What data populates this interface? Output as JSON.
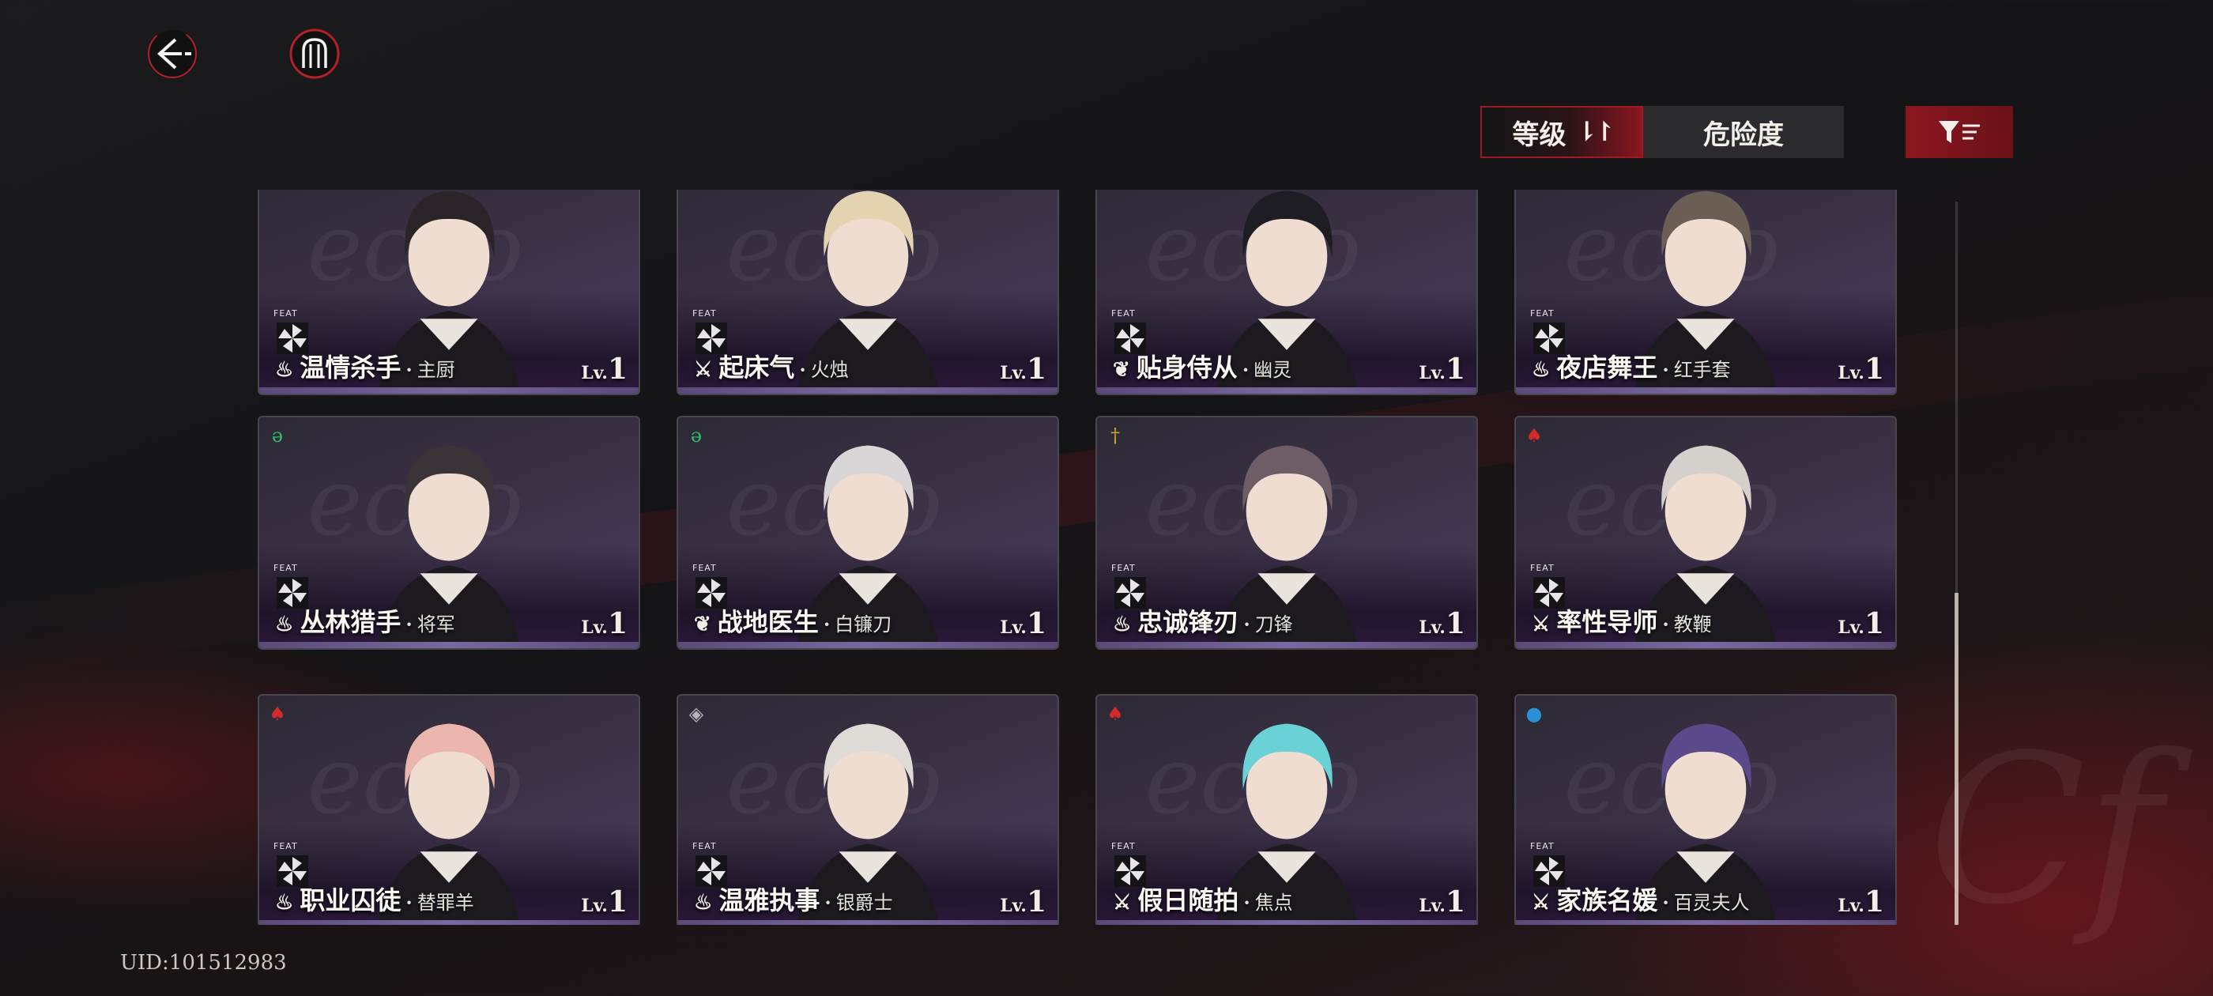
{
  "uid": "UID:101512983",
  "sort": {
    "level_label": "等级",
    "danger_label": "危险度"
  },
  "icons": {
    "back": "back-arrow-icon",
    "menu": "menu-emblem-icon",
    "filter": "filter-icon",
    "sort": "sort-arrows-icon"
  },
  "colors": {
    "accent_red": "#a01a24",
    "card_purple": "#4b3d5e",
    "green_tag": "#2fbf6a",
    "red_tag": "#d32a2a",
    "gold_tag": "#d9a62a",
    "blue_tag": "#2a8fd3"
  },
  "feat_label": "FEAT",
  "cards": [
    {
      "name": "温情杀手",
      "costume": "主厨",
      "lv_label": "Lv.",
      "level": "1",
      "role_icon": "flame-icon",
      "corner": ""
    },
    {
      "name": "起床气",
      "costume": "火烛",
      "lv_label": "Lv.",
      "level": "1",
      "role_icon": "crossed-swords-icon",
      "corner": ""
    },
    {
      "name": "贴身侍从",
      "costume": "幽灵",
      "lv_label": "Lv.",
      "level": "1",
      "role_icon": "wings-icon",
      "corner": ""
    },
    {
      "name": "夜店舞王",
      "costume": "红手套",
      "lv_label": "Lv.",
      "level": "1",
      "role_icon": "flame-icon",
      "corner": ""
    },
    {
      "name": "丛林猎手",
      "costume": "将军",
      "lv_label": "Lv.",
      "level": "1",
      "role_icon": "flame-icon",
      "corner": "green"
    },
    {
      "name": "战地医生",
      "costume": "白镰刀",
      "lv_label": "Lv.",
      "level": "1",
      "role_icon": "wings-icon",
      "corner": "green"
    },
    {
      "name": "忠诚锋刃",
      "costume": "刀锋",
      "lv_label": "Lv.",
      "level": "1",
      "role_icon": "flame-icon",
      "corner": "gold"
    },
    {
      "name": "率性导师",
      "costume": "教鞭",
      "lv_label": "Lv.",
      "level": "1",
      "role_icon": "crossed-swords-icon",
      "corner": "red"
    },
    {
      "name": "职业囚徒",
      "costume": "替罪羊",
      "lv_label": "Lv.",
      "level": "1",
      "role_icon": "flame-icon",
      "corner": "red"
    },
    {
      "name": "温雅执事",
      "costume": "银爵士",
      "lv_label": "Lv.",
      "level": "1",
      "role_icon": "flame-icon",
      "corner": "grey"
    },
    {
      "name": "假日随拍",
      "costume": "焦点",
      "lv_label": "Lv.",
      "level": "1",
      "role_icon": "crossed-swords-icon",
      "corner": "red"
    },
    {
      "name": "家族名媛",
      "costume": "百灵夫人",
      "lv_label": "Lv.",
      "level": "1",
      "role_icon": "crossed-swords-icon",
      "corner": "blue"
    }
  ]
}
